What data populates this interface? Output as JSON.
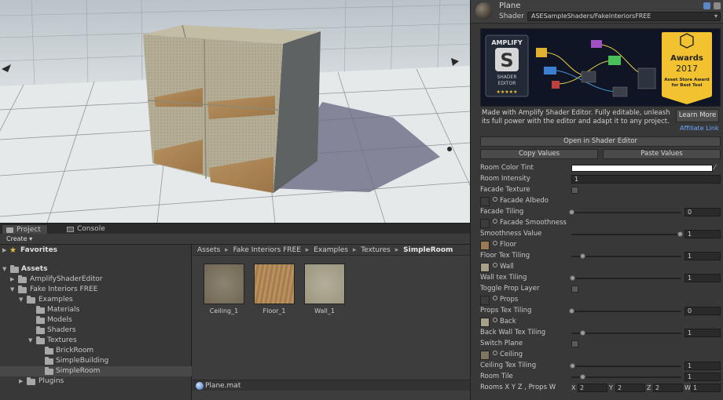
{
  "colors": {
    "panel_bg": "#383838",
    "accent_link": "#6aa8ff",
    "room_color_tint": "#ffffff",
    "wood": "#b08a5c",
    "wall": "#b8b29c"
  },
  "scene": {},
  "bottom_tabs": [
    {
      "label": "Project",
      "icon": "folder-icon",
      "active": true
    },
    {
      "label": "Console",
      "icon": "console-icon",
      "active": false
    }
  ],
  "toolbar": {
    "create_label": "Create ▾"
  },
  "tree": {
    "favorites_label": "Favorites",
    "items": [
      {
        "label": "Assets",
        "depth": 0
      },
      {
        "label": "AmplifyShaderEditor",
        "depth": 1
      },
      {
        "label": "Fake Interiors FREE",
        "depth": 1
      },
      {
        "label": "Examples",
        "depth": 2
      },
      {
        "label": "Materials",
        "depth": 3
      },
      {
        "label": "Models",
        "depth": 3
      },
      {
        "label": "Shaders",
        "depth": 3
      },
      {
        "label": "Textures",
        "depth": 3
      },
      {
        "label": "BrickRoom",
        "depth": 4
      },
      {
        "label": "SimpleBuilding",
        "depth": 4
      },
      {
        "label": "SimpleRoom",
        "depth": 4
      },
      {
        "label": "Plugins",
        "depth": 1
      }
    ]
  },
  "breadcrumb": {
    "parts": [
      "Assets",
      "Fake Interiors FREE",
      "Examples",
      "Textures"
    ],
    "current": "SimpleRoom",
    "separator": "▸"
  },
  "assets": [
    {
      "label": "Ceiling_1",
      "color": "#7d7461"
    },
    {
      "label": "Floor_1",
      "color": "#b08a5c"
    },
    {
      "label": "Wall_1",
      "color": "#a9a48f"
    }
  ],
  "status": {
    "selected_file": "Plane.mat"
  },
  "inspector": {
    "material_name": "Plane",
    "shader_label": "Shader",
    "shader_value": "ASESampleShaders/FakeInteriorsFREE",
    "banner": {
      "logo_line1": "AMPLIFY",
      "logo_letter": "S",
      "logo_line2": "SHADER",
      "logo_line3": "EDITOR",
      "stars": "★★★★★",
      "awards_title": "Awards",
      "awards_year": "2017",
      "awards_subtitle1": "Asset Store Award",
      "awards_subtitle2": "for Best Tool"
    },
    "made_text": "Made with Amplify Shader Editor. Fully editable, unleash its full power with the editor and adapt it to any project.",
    "learn_more": "Learn More",
    "affiliate": "Affiliate Link",
    "open_in_editor": "Open in Shader Editor",
    "copy_values": "Copy Values",
    "paste_values": "Paste Values"
  },
  "properties": {
    "room_color_tint": {
      "label": "Room Color Tint"
    },
    "room_intensity": {
      "label": "Room Intensity",
      "value": "1"
    },
    "facade_texture": {
      "label": "Facade Texture"
    },
    "facade_albedo": {
      "label": "Facade Albedo"
    },
    "facade_tiling": {
      "label": "Facade Tiling",
      "value": "0",
      "fraction": 0.0
    },
    "facade_smoothness": {
      "label": "Facade Smoothness"
    },
    "smoothness_value": {
      "label": "Smoothness Value",
      "value": "1",
      "fraction": 1.0
    },
    "floor": {
      "label": "Floor"
    },
    "floor_tex_tiling": {
      "label": "Floor Tex Tiling",
      "value": "1",
      "fraction": 0.1
    },
    "wall": {
      "label": "Wall"
    },
    "wall_tex_tiling": {
      "label": "Wall tex Tiling",
      "value": "1",
      "fraction": 0.0
    },
    "toggle_prop_layer": {
      "label": "Toggle Prop Layer"
    },
    "props": {
      "label": "Props"
    },
    "props_tex_tiling": {
      "label": "Props Tex Tiling",
      "value": "0",
      "fraction": 0.0
    },
    "back": {
      "label": "Back"
    },
    "back_wall_tex_tiling": {
      "label": "Back Wall Tex Tiling",
      "value": "1",
      "fraction": 0.1
    },
    "switch_plane": {
      "label": "Switch Plane"
    },
    "ceiling": {
      "label": "Ceiling"
    },
    "ceiling_tex_tiling": {
      "label": "Ceiling Tex Tiling",
      "value": "1",
      "fraction": 0.0
    },
    "room_tile": {
      "label": "Room Tile",
      "value": "1",
      "fraction": 0.1
    },
    "rooms_xyz": {
      "label": "Rooms X Y Z , Props W",
      "x": "2",
      "y": "2",
      "z": "2",
      "w": "1",
      "x_label": "X",
      "y_label": "Y",
      "z_label": "Z",
      "w_label": "W"
    }
  }
}
